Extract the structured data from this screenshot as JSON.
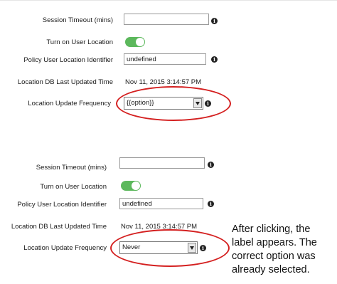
{
  "top_form": {
    "session_timeout_label": "Session Timeout (mins)",
    "session_timeout_value": "",
    "user_location_label": "Turn on User Location",
    "user_location_on": true,
    "policy_identifier_label": "Policy User Location Identifier",
    "policy_identifier_value": "undefined",
    "db_updated_label": "Location DB Last Updated Time",
    "db_updated_value": "Nov 11, 2015 3:14:57 PM",
    "update_frequency_label": "Location Update Frequency",
    "update_frequency_value": "{{option}}"
  },
  "bottom_form": {
    "session_timeout_label": "Session Timeout (mins)",
    "session_timeout_value": "",
    "user_location_label": "Turn on User Location",
    "user_location_on": true,
    "policy_identifier_label": "Policy User Location Identifier",
    "policy_identifier_value": "undefined",
    "db_updated_label": "Location DB Last Updated Time",
    "db_updated_value": "Nov 11, 2015 3:14:57 PM",
    "update_frequency_label": "Location Update Frequency",
    "update_frequency_value": "Never"
  },
  "annotation": {
    "note": "After clicking, the label appears.  The correct option was already selected.",
    "highlight_color": "#d42020"
  },
  "icons": {
    "info": "info-icon",
    "toggle": "toggle-switch",
    "dropdown": "chevron-down-icon"
  },
  "colors": {
    "toggle_on": "#5cb85c"
  }
}
